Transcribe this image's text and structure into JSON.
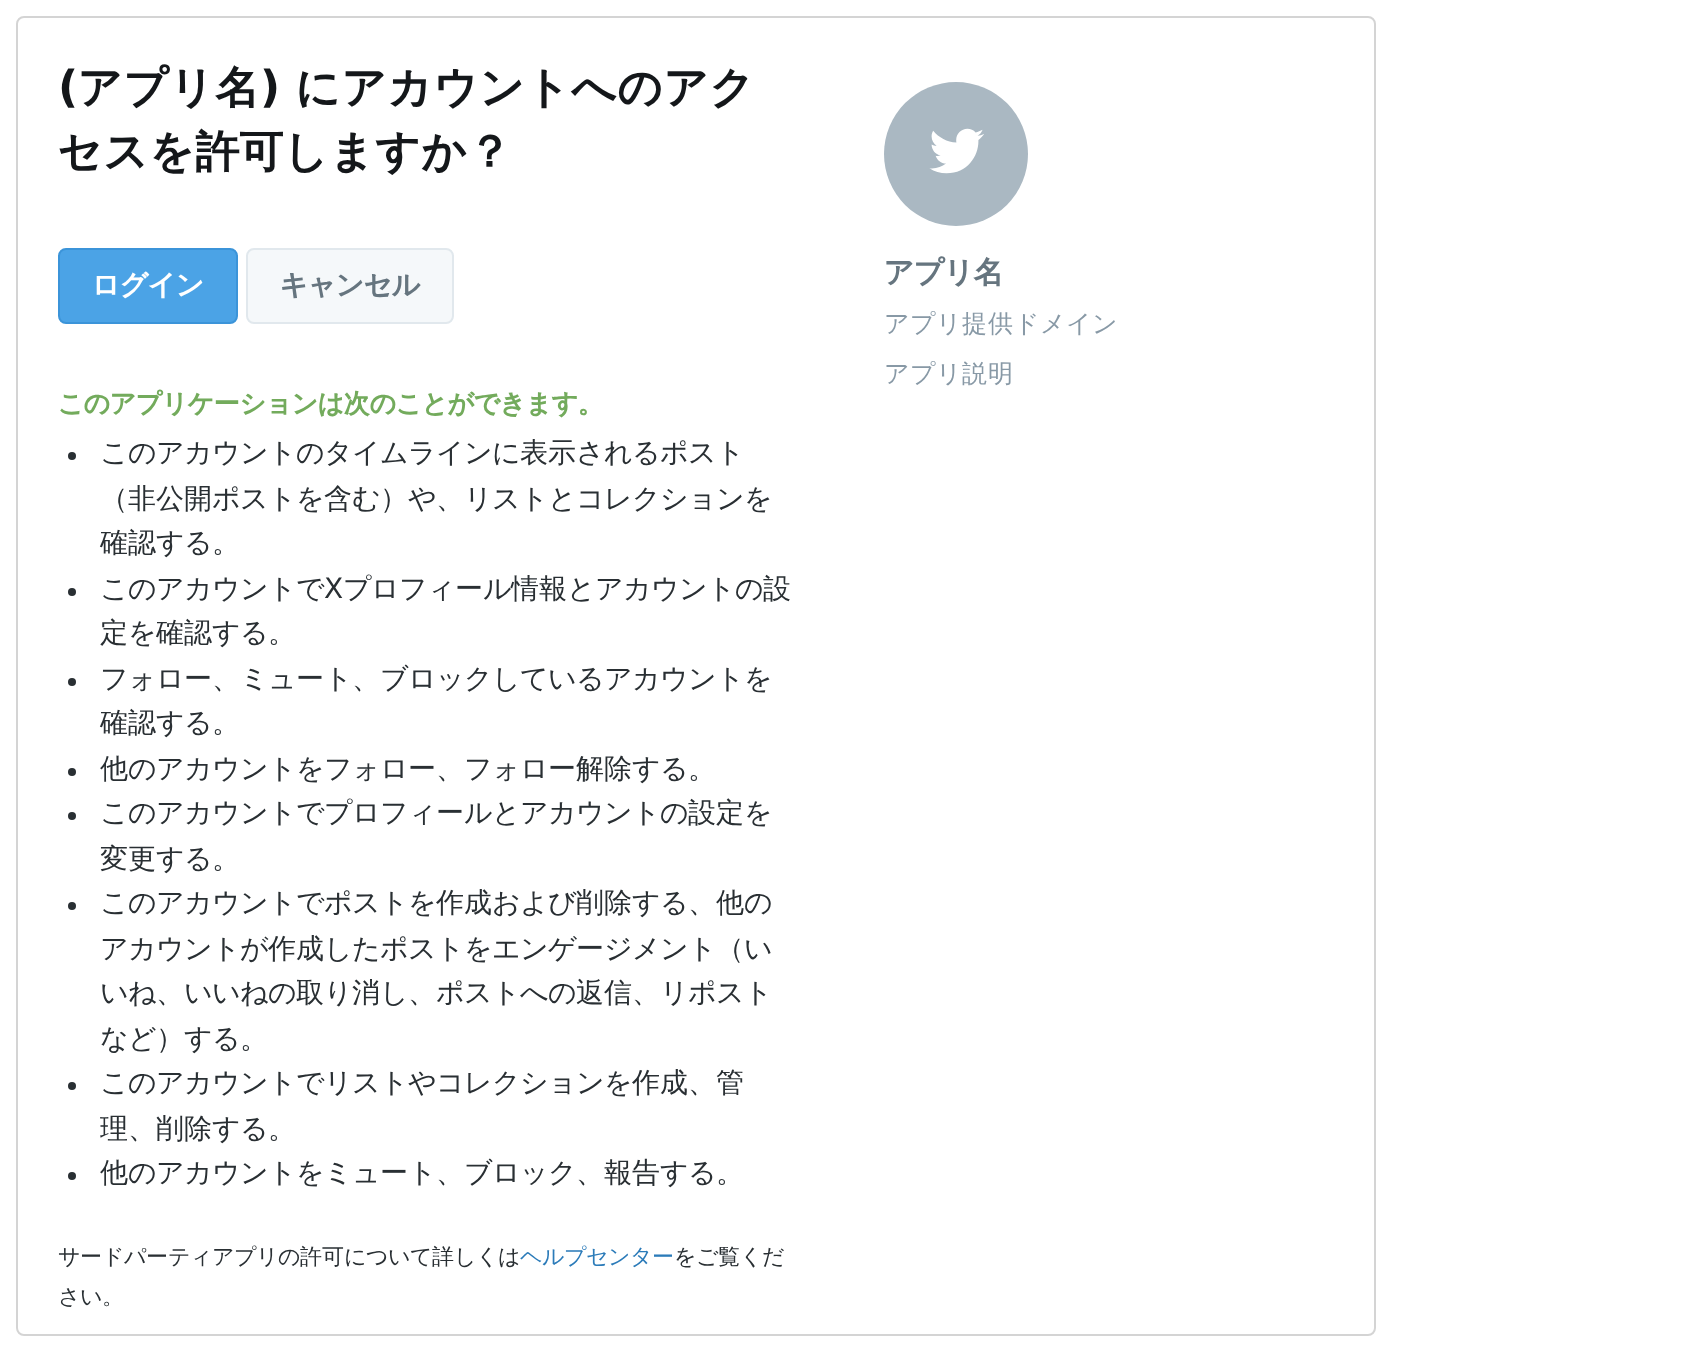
{
  "title": "(アプリ名) にアカウントへのアクセスを許可しますか？",
  "buttons": [
    {
      "label": "ログイン",
      "kind": "primary"
    },
    {
      "label": "キャンセル",
      "kind": "secondary"
    }
  ],
  "permissions_heading": "このアプリケーションは次のことができます。",
  "permissions": [
    "このアカウントのタイムラインに表示されるポスト（非公開ポストを含む）や、リストとコレクションを確認する。",
    "このアカウントでXプロフィール情報とアカウントの設定を確認する。",
    "フォロー、ミュート、ブロックしているアカウントを確認する。",
    "他のアカウントをフォロー、フォロー解除する。",
    "このアカウントでプロフィールとアカウントの設定を変更する。",
    "このアカウントでポストを作成および削除する、他のアカウントが作成したポストをエンゲージメント（いいね、いいねの取り消し、ポストへの返信、リポストなど）する。",
    "このアカウントでリストやコレクションを作成、管理、削除する。",
    "他のアカウントをミュート、ブロック、報告する。"
  ],
  "footer": {
    "before": "サードパーティアプリの許可について詳しくは",
    "link": "ヘルプセンター",
    "after": "をご覧ください。"
  },
  "app": {
    "name": "アプリ名",
    "domain": "アプリ提供ドメイン",
    "description": "アプリ説明"
  }
}
